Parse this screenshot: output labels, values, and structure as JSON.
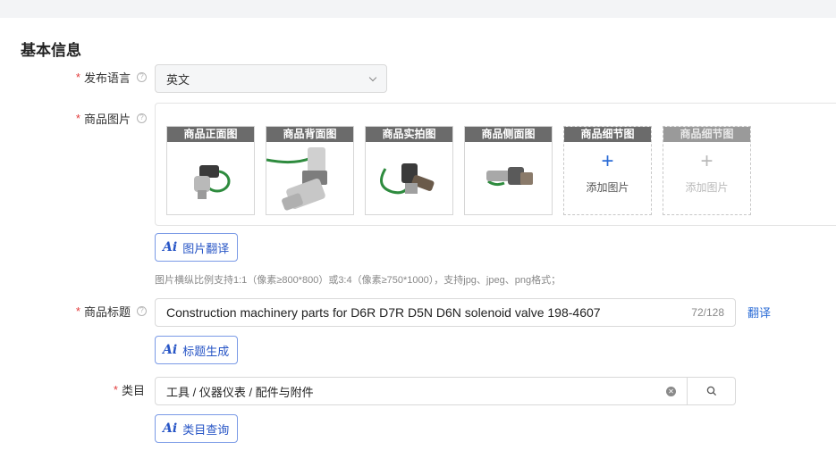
{
  "section": {
    "title": "基本信息"
  },
  "fields": {
    "language": {
      "label": "发布语言",
      "value": "英文"
    },
    "images": {
      "label": "商品图片",
      "slots": [
        {
          "caption": "商品正面图",
          "image": "solenoid-valve-front"
        },
        {
          "caption": "商品背面图",
          "image": "solenoid-valve-back"
        },
        {
          "caption": "商品实拍图",
          "image": "solenoid-valve-real"
        },
        {
          "caption": "商品侧面图",
          "image": "solenoid-valve-side"
        }
      ],
      "add_slots": [
        {
          "caption": "商品细节图",
          "add_label": "添加图片",
          "state": "enabled"
        },
        {
          "caption": "商品细节图",
          "add_label": "添加图片",
          "state": "disabled"
        }
      ],
      "translate_button": "图片翻译",
      "hint": "图片横纵比例支持1:1（像素≥800*800）或3:4（像素≥750*1000），支持jpg、jpeg、png格式；"
    },
    "title": {
      "label": "商品标题",
      "value": "Construction machinery parts for D6R D7R D5N D6N solenoid valve 198-4607",
      "counter": "72/128",
      "translate_link": "翻译",
      "generate_button": "标题生成"
    },
    "category": {
      "label": "类目",
      "value": "工具 / 仪器仪表 / 配件与附件",
      "query_button": "类目查询"
    }
  },
  "common": {
    "required_mark": "*",
    "ai_mark": "Ai",
    "help_mark": "?",
    "plus_mark": "+"
  },
  "colors": {
    "accent": "#2b6cd6",
    "required": "#e23c3c",
    "caption_bg": "#6b6b6b"
  }
}
